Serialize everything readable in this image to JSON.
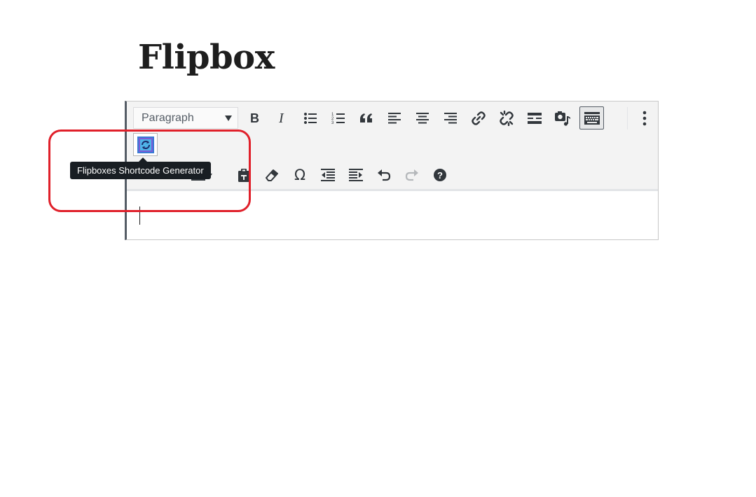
{
  "page": {
    "title": "Flipbox"
  },
  "toolbar": {
    "format_select": "Paragraph",
    "buttons": [
      {
        "name": "bold-button",
        "icon": "bold-icon",
        "label": "B"
      },
      {
        "name": "italic-button",
        "icon": "italic-icon",
        "label": "I"
      },
      {
        "name": "bulleted-list-button",
        "icon": "bullet-list-icon"
      },
      {
        "name": "numbered-list-button",
        "icon": "numbered-list-icon"
      },
      {
        "name": "blockquote-button",
        "icon": "quote-icon"
      },
      {
        "name": "align-left-button",
        "icon": "align-left-icon"
      },
      {
        "name": "align-center-button",
        "icon": "align-center-icon"
      },
      {
        "name": "align-right-button",
        "icon": "align-right-icon"
      },
      {
        "name": "insert-link-button",
        "icon": "link-icon"
      },
      {
        "name": "remove-link-button",
        "icon": "unlink-icon"
      },
      {
        "name": "read-more-button",
        "icon": "read-more-icon"
      },
      {
        "name": "add-media-button",
        "icon": "media-icon"
      },
      {
        "name": "toolbar-toggle-button",
        "icon": "keyboard-icon",
        "active": true
      },
      {
        "name": "more-options-button",
        "icon": "vertical-ellipsis-icon"
      }
    ],
    "row2": [
      {
        "name": "text-color-button",
        "icon": "text-color-icon"
      },
      {
        "name": "paste-as-text-button",
        "icon": "clipboard-icon"
      },
      {
        "name": "clear-formatting-button",
        "icon": "eraser-icon"
      },
      {
        "name": "special-character-button",
        "icon": "omega-icon",
        "label": "Ω"
      },
      {
        "name": "decrease-indent-button",
        "icon": "outdent-icon"
      },
      {
        "name": "increase-indent-button",
        "icon": "indent-icon"
      },
      {
        "name": "undo-button",
        "icon": "undo-icon"
      },
      {
        "name": "redo-button",
        "icon": "redo-icon"
      },
      {
        "name": "help-button",
        "icon": "help-icon"
      }
    ],
    "flipbox_button": {
      "icon": "flipbox-generator-icon"
    }
  },
  "tooltip": {
    "text": "Flipboxes Shortcode Generator"
  },
  "colors": {
    "highlight": "#e0202a",
    "tooltip_bg": "#191e23",
    "icon": "#32373c"
  }
}
